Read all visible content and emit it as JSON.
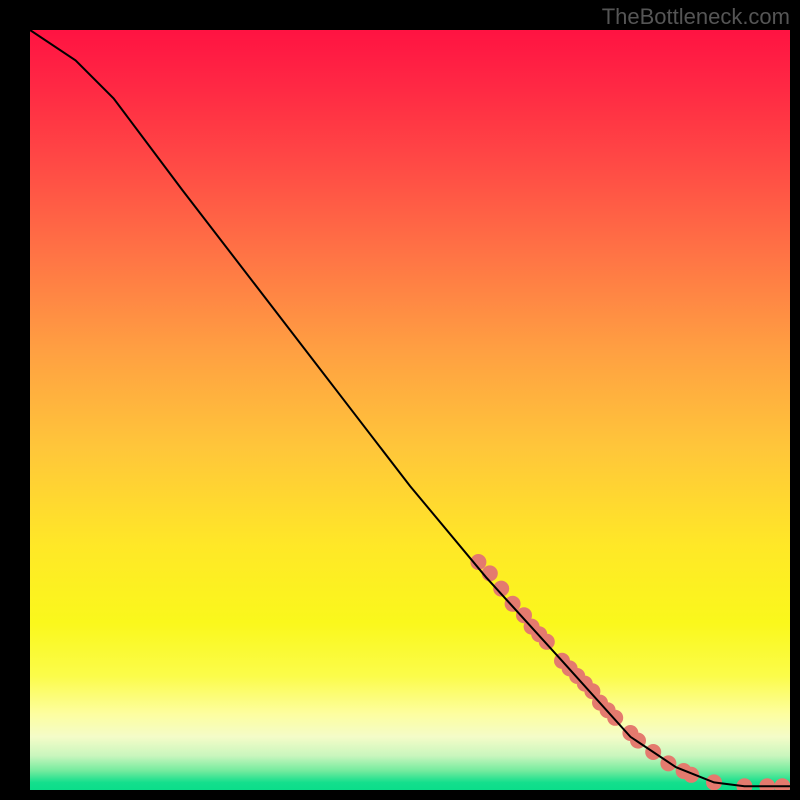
{
  "watermark": "TheBottleneck.com",
  "chart_data": {
    "type": "line",
    "title": "",
    "xlabel": "",
    "ylabel": "",
    "xlim": [
      0,
      100
    ],
    "ylim": [
      0,
      100
    ],
    "curve": {
      "name": "bottleneck-curve",
      "color": "#000000",
      "points_xy": [
        [
          0,
          100
        ],
        [
          6,
          96
        ],
        [
          11,
          91
        ],
        [
          20,
          79
        ],
        [
          30,
          66
        ],
        [
          40,
          53
        ],
        [
          50,
          40
        ],
        [
          60,
          28
        ],
        [
          70,
          17
        ],
        [
          79,
          7
        ],
        [
          85,
          3
        ],
        [
          90,
          1
        ],
        [
          94,
          0.5
        ],
        [
          97,
          0.5
        ],
        [
          100,
          0.5
        ]
      ]
    },
    "markers": {
      "color": "#e47a6e",
      "radius_px": 8,
      "points_xy": [
        [
          59,
          30
        ],
        [
          60.5,
          28.5
        ],
        [
          62,
          26.5
        ],
        [
          63.5,
          24.5
        ],
        [
          65,
          23
        ],
        [
          66,
          21.5
        ],
        [
          67,
          20.5
        ],
        [
          68,
          19.5
        ],
        [
          70,
          17
        ],
        [
          71,
          16
        ],
        [
          72,
          15
        ],
        [
          73,
          14
        ],
        [
          74,
          13
        ],
        [
          75,
          11.5
        ],
        [
          76,
          10.5
        ],
        [
          77,
          9.5
        ],
        [
          79,
          7.5
        ],
        [
          80,
          6.5
        ],
        [
          82,
          5
        ],
        [
          84,
          3.5
        ],
        [
          86,
          2.5
        ],
        [
          87,
          2
        ],
        [
          90,
          1
        ],
        [
          94,
          0.5
        ],
        [
          97,
          0.5
        ],
        [
          99,
          0.5
        ]
      ]
    },
    "gradient_stops": [
      {
        "pos": 0.0,
        "color": "#ff1342"
      },
      {
        "pos": 0.08,
        "color": "#ff2a44"
      },
      {
        "pos": 0.18,
        "color": "#ff4b45"
      },
      {
        "pos": 0.3,
        "color": "#ff7545"
      },
      {
        "pos": 0.42,
        "color": "#ff9f42"
      },
      {
        "pos": 0.55,
        "color": "#ffc63a"
      },
      {
        "pos": 0.68,
        "color": "#ffe827"
      },
      {
        "pos": 0.78,
        "color": "#faf81c"
      },
      {
        "pos": 0.85,
        "color": "#fbfc4a"
      },
      {
        "pos": 0.9,
        "color": "#fdfea0"
      },
      {
        "pos": 0.93,
        "color": "#f4fcc8"
      },
      {
        "pos": 0.955,
        "color": "#c9f6bd"
      },
      {
        "pos": 0.975,
        "color": "#73eb9e"
      },
      {
        "pos": 0.99,
        "color": "#14df8d"
      },
      {
        "pos": 1.0,
        "color": "#0bdd8a"
      }
    ]
  }
}
